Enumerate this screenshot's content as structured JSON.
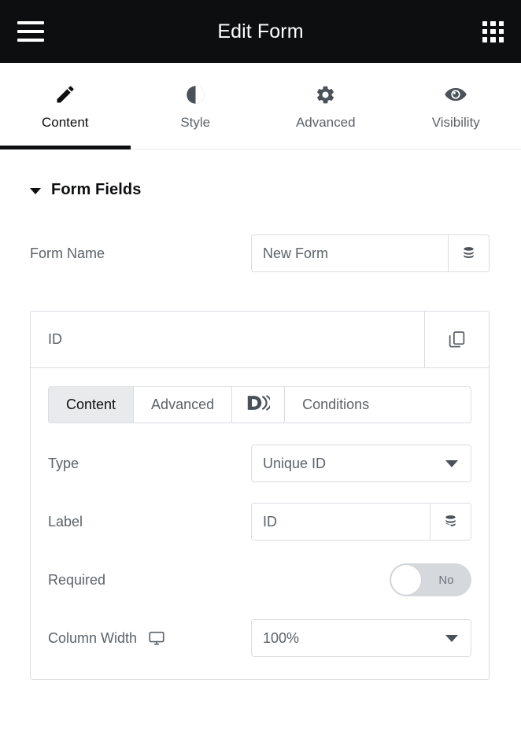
{
  "topbar": {
    "title": "Edit Form",
    "menu_icon": "hamburger-menu-icon",
    "apps_icon": "grid-apps-icon"
  },
  "tabs": [
    {
      "label": "Content",
      "icon": "pencil-icon",
      "active": true
    },
    {
      "label": "Style",
      "icon": "contrast-icon",
      "active": false
    },
    {
      "label": "Advanced",
      "icon": "gear-icon",
      "active": false
    },
    {
      "label": "Visibility",
      "icon": "eye-icon",
      "active": false
    }
  ],
  "section": {
    "title": "Form Fields",
    "expanded": true
  },
  "form_name": {
    "label": "Form Name",
    "value": "New Form",
    "placeholder": "Form Name",
    "dynamic_icon": "database-icon"
  },
  "field_card": {
    "head": {
      "name": "ID",
      "duplicate_icon": "copy-icon"
    },
    "subtabs": [
      {
        "label": "Content",
        "icon": null,
        "active": true
      },
      {
        "label": "Advanced",
        "icon": null,
        "active": false
      },
      {
        "label": "",
        "icon": "dynamic-d-icon",
        "active": false
      },
      {
        "label": "Conditions",
        "icon": null,
        "active": false
      }
    ],
    "rows": {
      "type": {
        "label": "Type",
        "value": "Unique ID"
      },
      "field_label": {
        "label": "Label",
        "value": "ID",
        "placeholder": "Label",
        "dynamic_icon": "database-icon"
      },
      "required": {
        "label": "Required",
        "value": "No",
        "on": false
      },
      "column_width": {
        "label": "Column Width",
        "device_icon": "desktop-icon",
        "value": "100%"
      }
    }
  },
  "colors": {
    "topbar_bg": "#0d0e10",
    "accent": "#0d0e10",
    "text": "#5b6268",
    "border": "#d9dde2",
    "subtab_active_bg": "#e8eaec",
    "toggle_track": "#d5d8dd"
  }
}
